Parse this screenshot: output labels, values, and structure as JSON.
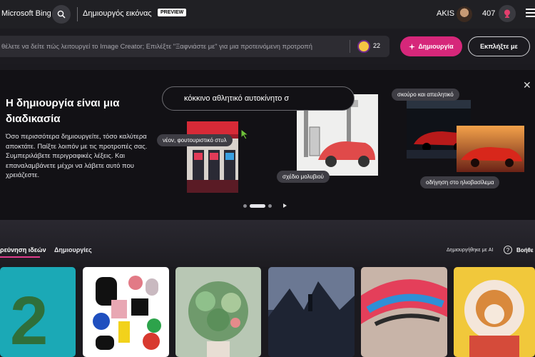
{
  "header": {
    "brand": "Microsoft Bing",
    "page_title": "Δημιουργός εικόνας",
    "preview_badge": "PREVIEW",
    "user_name": "AKIS",
    "rewards_points": "407"
  },
  "prompt_bar": {
    "placeholder": "θέλετε να δείτε πώς λειτουργεί το Image Creator; Επιλέξτε \"Ξαφνιάστε με\" για μια προτεινόμενη προτροπή",
    "boosts": "22",
    "create_label": "Δημιουργία",
    "surprise_label": "Εκπλήξτε με"
  },
  "banner": {
    "heading": "Η δημιουργία είναι μια διαδικασία",
    "body": "Όσο περισσότερα δημιουργείτε, τόσο καλύτερα αποκτάτε. Παίξτε λοιπόν με τις προτροπές σας. Συμπεριλάβετε περιγραφικές λέξεις. Και επαναλαμβάνετε μέχρι να λάβετε αυτό που χρειάζεστε.",
    "query": "κόκκινο αθλητικό αυτοκίνητο σ",
    "tags": {
      "neon": "νέον, φουτουριστικό στυλ",
      "pencil": "σχέδιο μολυβιού",
      "dark": "σκούρο και απειλητικό",
      "sunset": "οδήγηση στο ηλιοβασίλεμα"
    }
  },
  "gallery": {
    "tab_explore": "ρεύνηση ιδεών",
    "tab_creations": "Δημιουργίες",
    "ai_note": "Δημιουργήθηκε με AI",
    "help_label": "Βοήθε"
  },
  "icons": {
    "search": "search-icon",
    "trophy": "trophy-icon",
    "menu": "hamburger-icon",
    "boost": "boost-coin-icon",
    "close": "close-icon",
    "play": "play-icon",
    "help": "help-icon"
  },
  "colors": {
    "accent": "#d6277a",
    "background": "#1b1a1f"
  }
}
